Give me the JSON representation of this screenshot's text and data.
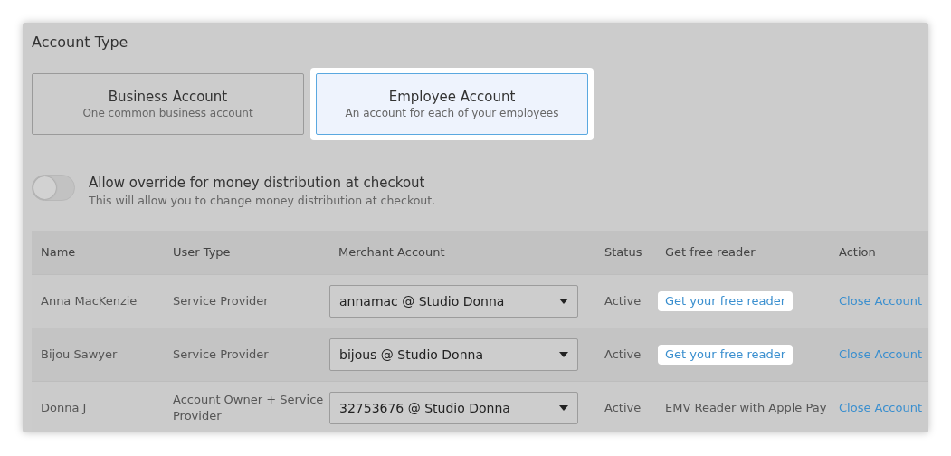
{
  "section_title": "Account Type",
  "account_types": [
    {
      "title": "Business Account",
      "subtitle": "One common business account",
      "selected": false
    },
    {
      "title": "Employee Account",
      "subtitle": "An account for each of your employees",
      "selected": true
    }
  ],
  "override_toggle": {
    "on": false,
    "label": "Allow override for money distribution at checkout",
    "description": "This will allow you to change money distribution at checkout."
  },
  "table": {
    "columns": [
      "Name",
      "User Type",
      "Merchant Account",
      "Status",
      "Get free reader",
      "Action"
    ],
    "rows": [
      {
        "name": "Anna MacKenzie",
        "user_type": "Service Provider",
        "merchant_account": "annamac @ Studio Donna",
        "status": "Active",
        "reader": {
          "kind": "link",
          "text": "Get your free reader"
        },
        "action": "Close Account"
      },
      {
        "name": "Bijou Sawyer",
        "user_type": "Service Provider",
        "merchant_account": "bijous @ Studio Donna",
        "status": "Active",
        "reader": {
          "kind": "link",
          "text": "Get your free reader"
        },
        "action": "Close Account"
      },
      {
        "name": "Donna J",
        "user_type": "Account Owner + Service Provider",
        "merchant_account": "32753676 @ Studio Donna",
        "status": "Active",
        "reader": {
          "kind": "text",
          "text": "EMV Reader with Apple Pay"
        },
        "action": "Close Account"
      }
    ]
  }
}
